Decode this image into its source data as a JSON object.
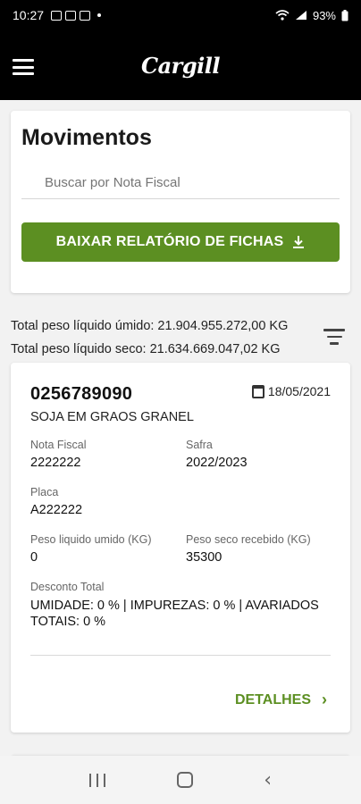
{
  "status_bar": {
    "time": "10:27",
    "battery": "93%"
  },
  "header": {
    "logo": "Cargill"
  },
  "movements": {
    "title": "Movimentos",
    "search_placeholder": "Buscar por Nota Fiscal",
    "report_button": "BAIXAR RELATÓRIO DE FICHAS"
  },
  "totals": {
    "wet": "Total peso líquido úmido: 21.904.955.272,00 KG",
    "dry": "Total peso líquido seco: 21.634.669.047,02 KG"
  },
  "card": {
    "number": "0256789090",
    "date": "18/05/2021",
    "product": "SOJA EM GRAOS GRANEL",
    "fields": {
      "nota_fiscal_label": "Nota Fiscal",
      "nota_fiscal_value": "2222222",
      "safra_label": "Safra",
      "safra_value": "2022/2023",
      "placa_label": "Placa",
      "placa_value": "A222222",
      "peso_liquido_label": "Peso liquido umido (KG)",
      "peso_liquido_value": "0",
      "peso_seco_label": "Peso seco recebido (KG)",
      "peso_seco_value": "35300",
      "desconto_label": "Desconto Total",
      "desconto_value": "UMIDADE: 0 % | IMPUREZAS: 0 % | AVARIADOS TOTAIS: 0 %"
    },
    "details_link": "DETALHES"
  },
  "icons": {
    "menu": "hamburger-menu-icon",
    "download": "download-icon",
    "filter": "filter-icon",
    "calendar": "calendar-icon",
    "chevron": "chevron-right-icon"
  },
  "colors": {
    "accent": "#5c8f22",
    "app_bar": "#000000"
  }
}
